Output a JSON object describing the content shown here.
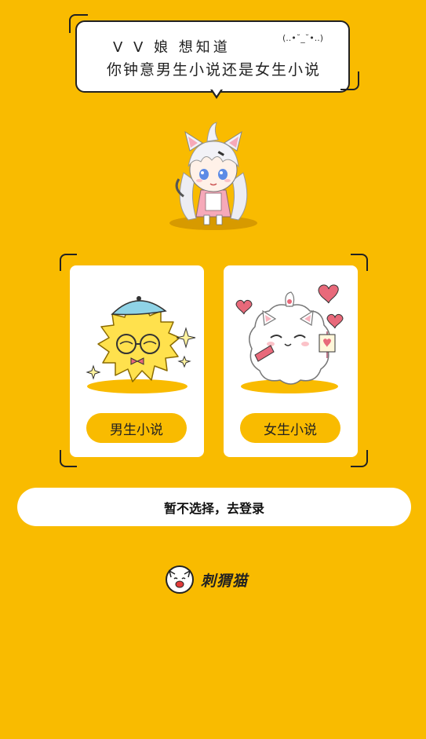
{
  "bubble": {
    "line1": "V V 娘 想知道",
    "emote": "(..•˘_˘•..)",
    "line2": "你钟意男生小说还是女生小说"
  },
  "cards": {
    "male": {
      "label": "男生小说"
    },
    "female": {
      "label": "女生小说"
    }
  },
  "skip_button": {
    "label": "暂不选择，去登录"
  },
  "brand": {
    "name": "刺猬猫"
  },
  "colors": {
    "background": "#F9BB00",
    "card": "#FFFFFF",
    "text": "#222222",
    "heart": "#E8697A"
  }
}
